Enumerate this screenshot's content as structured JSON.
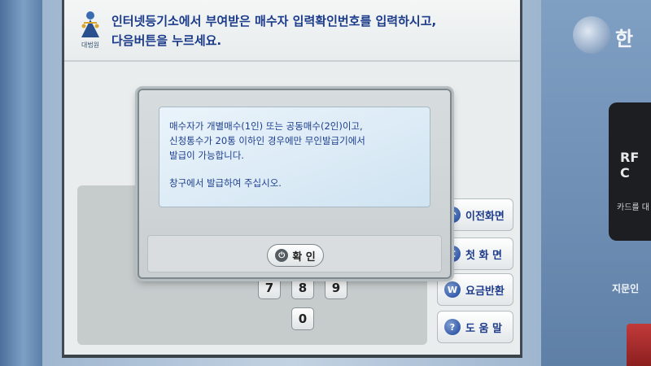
{
  "header": {
    "logo_text": "대법원",
    "instruction_line1": "인터넷등기소에서 부여받은 매수자 입력확인번호를 입력하시고,",
    "instruction_line2": "다음버튼을 누르세요."
  },
  "modal": {
    "lines": [
      "매수자가 개별매수(1인) 또는 공동매수(2인)이고,",
      "신청통수가 20통 이하인 경우에만 무인발급기에서",
      "발급이 가능합니다."
    ],
    "footer_line": "창구에서 발급하여 주십시오.",
    "ok_label": "확 인"
  },
  "keypad": {
    "keys": [
      "7",
      "8",
      "9",
      "0"
    ]
  },
  "side_menu": {
    "items": [
      {
        "label": "이전화면",
        "icon": "back-arrow-icon"
      },
      {
        "label": "첫 화 면",
        "icon": "home-c-icon"
      },
      {
        "label": "요금반환",
        "icon": "coin-w-icon"
      },
      {
        "label": "도 움 말",
        "icon": "question-icon"
      }
    ]
  },
  "kiosk": {
    "brand_char": "한",
    "rf_label": "RF C",
    "card_label": "카드를 대",
    "finger_label": "지문인"
  },
  "colors": {
    "accent_text": "#1a3a8a",
    "housing": "#6f8fb4"
  }
}
